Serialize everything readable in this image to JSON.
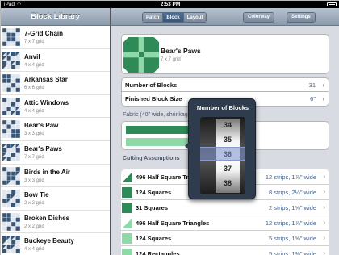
{
  "status_bar": {
    "carrier": "iPad",
    "time": "2:53 PM"
  },
  "sidebar": {
    "title": "Block Library",
    "items": [
      {
        "name": "7-Grid Chain",
        "grid": "7 x 7 grid"
      },
      {
        "name": "Anvil",
        "grid": "4 x 4 grid"
      },
      {
        "name": "Arkansas Star",
        "grid": "6 x 6 grid"
      },
      {
        "name": "Attic Windows",
        "grid": "4 x 4 grid"
      },
      {
        "name": "Bear's Paw",
        "grid": "3 x 3 grid"
      },
      {
        "name": "Bear's Paws",
        "grid": "7 x 7 grid"
      },
      {
        "name": "Birds in the Air",
        "grid": "3 x 3 grid"
      },
      {
        "name": "Bow Tie",
        "grid": "2 x 2 grid"
      },
      {
        "name": "Broken Dishes",
        "grid": "2 x 2 grid"
      },
      {
        "name": "Buckeye Beauty",
        "grid": "4 x 4 grid"
      }
    ]
  },
  "toolbar": {
    "tabs": [
      {
        "label": "Patch",
        "active": false
      },
      {
        "label": "Block",
        "active": true
      },
      {
        "label": "Layout",
        "active": false
      }
    ],
    "colorway_label": "Colorway",
    "settings_label": "Settings"
  },
  "block": {
    "name": "Bear's Paws",
    "grid": "7 x 7 grid",
    "color": "#2e8b57"
  },
  "settings": {
    "number_of_blocks_label": "Number of Blocks",
    "number_of_blocks_value": "31",
    "finished_size_label": "Finished Block Size",
    "finished_size_value": "6\""
  },
  "fabric": {
    "label": "Fabric (40\" wide, shrinkage..."
  },
  "cutting": {
    "title": "Cutting Assumptions",
    "rows": [
      {
        "name": "496 Half Square Triangles",
        "strips": "12 strips, 1⅞\" wide",
        "swatch": "half-dark"
      },
      {
        "name": "124 Squares",
        "strips": "8 strips, 2¼\" wide",
        "swatch": "dark"
      },
      {
        "name": "31 Squares",
        "strips": "2 strips, 1⅝\" wide",
        "swatch": "dark"
      },
      {
        "name": "496 Half Square Triangles",
        "strips": "12 strips, 1⅞\" wide",
        "swatch": "half-light"
      },
      {
        "name": "124 Squares",
        "strips": "5 strips, 1⅝\" wide",
        "swatch": "light"
      },
      {
        "name": "124 Rectangles",
        "strips": "5 strips, 1⅜\" wide",
        "swatch": "light"
      }
    ]
  },
  "picker": {
    "title": "Number of Blocks",
    "values": [
      "34",
      "35",
      "36",
      "37",
      "38"
    ],
    "selected": "36"
  },
  "colors": {
    "dark_green": "#2e8b57",
    "light_green": "#8fd8a8",
    "block_blue": "#3a5677"
  }
}
